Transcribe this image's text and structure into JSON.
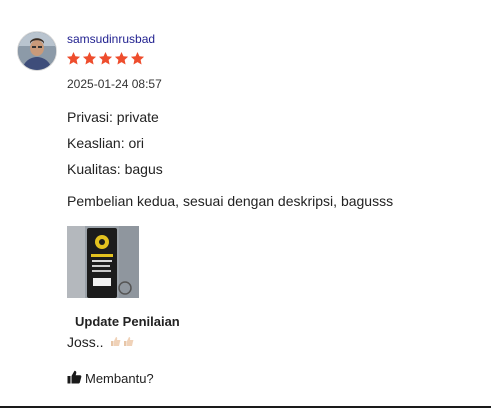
{
  "review": {
    "username": "samsudinrusbad",
    "rating": 5,
    "rating_max": 5,
    "star_color": "#ee4d2d",
    "timestamp": "2025-01-24 08:57",
    "attributes": [
      {
        "text": "Privasi: private"
      },
      {
        "text": "Keaslian: ori"
      },
      {
        "text": "Kualitas: bagus"
      }
    ],
    "text": "Pembelian kedua, sesuai dengan deskripsi, bagusss",
    "update": {
      "title": "Update Penilaian",
      "text": "Joss.."
    },
    "helpful_label": "Membantu?"
  },
  "icons": {
    "avatar": "user-avatar",
    "star": "star-icon",
    "thumbs_up": "thumbs-up-icon",
    "emoji": "thumbs-up-emoji"
  }
}
